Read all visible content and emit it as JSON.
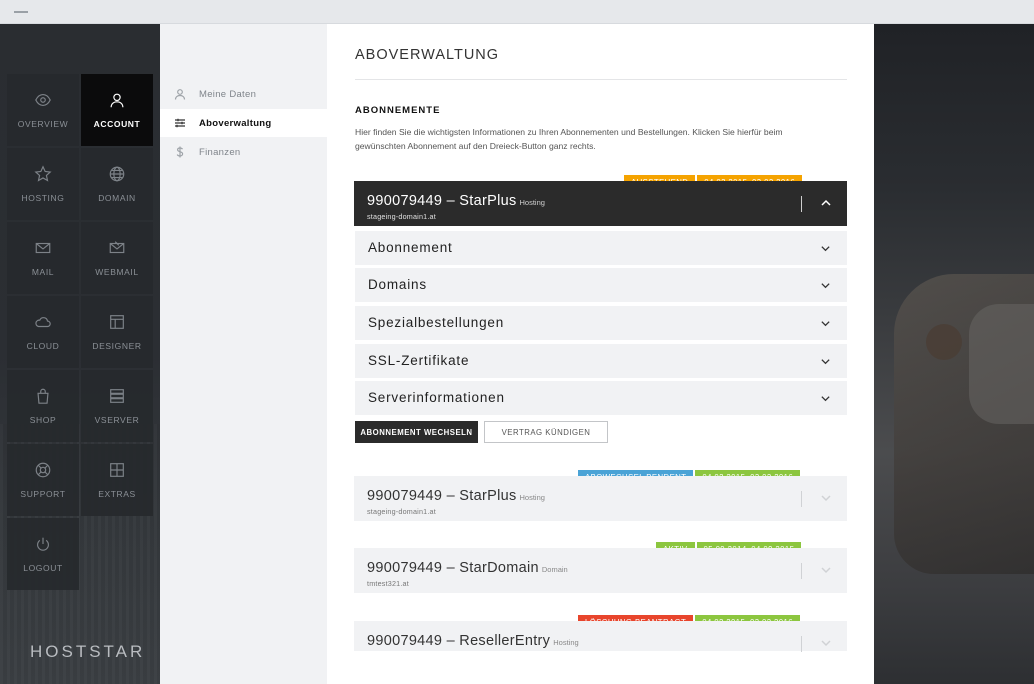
{
  "left_nav": {
    "items": [
      {
        "label": "OVERVIEW",
        "icon": "eye-icon"
      },
      {
        "label": "ACCOUNT",
        "icon": "user-icon"
      },
      {
        "label": "HOSTING",
        "icon": "star-icon"
      },
      {
        "label": "DOMAIN",
        "icon": "globe-icon"
      },
      {
        "label": "MAIL",
        "icon": "envelope-icon"
      },
      {
        "label": "WEBMAIL",
        "icon": "webmail-icon"
      },
      {
        "label": "CLOUD",
        "icon": "cloud-icon"
      },
      {
        "label": "DESIGNER",
        "icon": "layout-icon"
      },
      {
        "label": "SHOP",
        "icon": "bag-icon"
      },
      {
        "label": "VSERVER",
        "icon": "server-icon"
      },
      {
        "label": "SUPPORT",
        "icon": "lifebuoy-icon"
      },
      {
        "label": "EXTRAS",
        "icon": "grid-icon"
      },
      {
        "label": "LOGOUT",
        "icon": "power-icon"
      }
    ],
    "active": "ACCOUNT",
    "brand": "HOSTSTAR"
  },
  "sub_menu": {
    "items": [
      {
        "label": "Meine Daten",
        "icon": "user-icon"
      },
      {
        "label": "Aboverwaltung",
        "icon": "sliders-icon"
      },
      {
        "label": "Finanzen",
        "icon": "dollar-icon"
      }
    ],
    "active": "Aboverwaltung"
  },
  "main": {
    "title": "ABOVERWALTUNG",
    "section_title": "ABONNEMENTE",
    "section_desc": "Hier finden Sie die wichtigsten Informationen zu Ihren Abonnementen und Bestellungen. Klicken Sie hierfür beim gewünschten Abonnement auf den Dreieck-Button ganz rechts.",
    "subscriptions": [
      {
        "title": "990079449 – StarPlus",
        "type": "Hosting",
        "domain": "stageing-domain1.at",
        "status": "AUSSTEHEND",
        "status_color": "#f5a300",
        "period": "04.02.2015–03.02.2016",
        "period_color": "#f5a300",
        "expanded": true
      },
      {
        "title": "990079449 – StarPlus",
        "type": "Hosting",
        "domain": "stageing-domain1.at",
        "status": "ABOWECHSEL PENDENT",
        "status_color": "#4aa3d6",
        "period": "04.02.2015–03.02.2016",
        "period_color": "#8cc63f",
        "expanded": false
      },
      {
        "title": "990079449 – StarDomain",
        "type": "Domain",
        "domain": "tmtest321.at",
        "status": "AKTIV",
        "status_color": "#8cc63f",
        "period": "05.09.2014–04.09.2015",
        "period_color": "#8cc63f",
        "expanded": false
      },
      {
        "title": "990079449 – ResellerEntry",
        "type": "Hosting",
        "domain": "",
        "status": "LÖSCHUNG BEANTRAGT",
        "status_color": "#e8452c",
        "period": "04.02.2015–03.02.2016",
        "period_color": "#8cc63f",
        "expanded": false
      }
    ],
    "accordion": [
      "Abonnement",
      "Domains",
      "Spezialbestellungen",
      "SSL-Zertifikate",
      "Serverinformationen"
    ],
    "buttons": {
      "switch": "ABONNEMENT WECHSELN",
      "cancel": "VERTRAG KÜNDIGEN"
    }
  }
}
